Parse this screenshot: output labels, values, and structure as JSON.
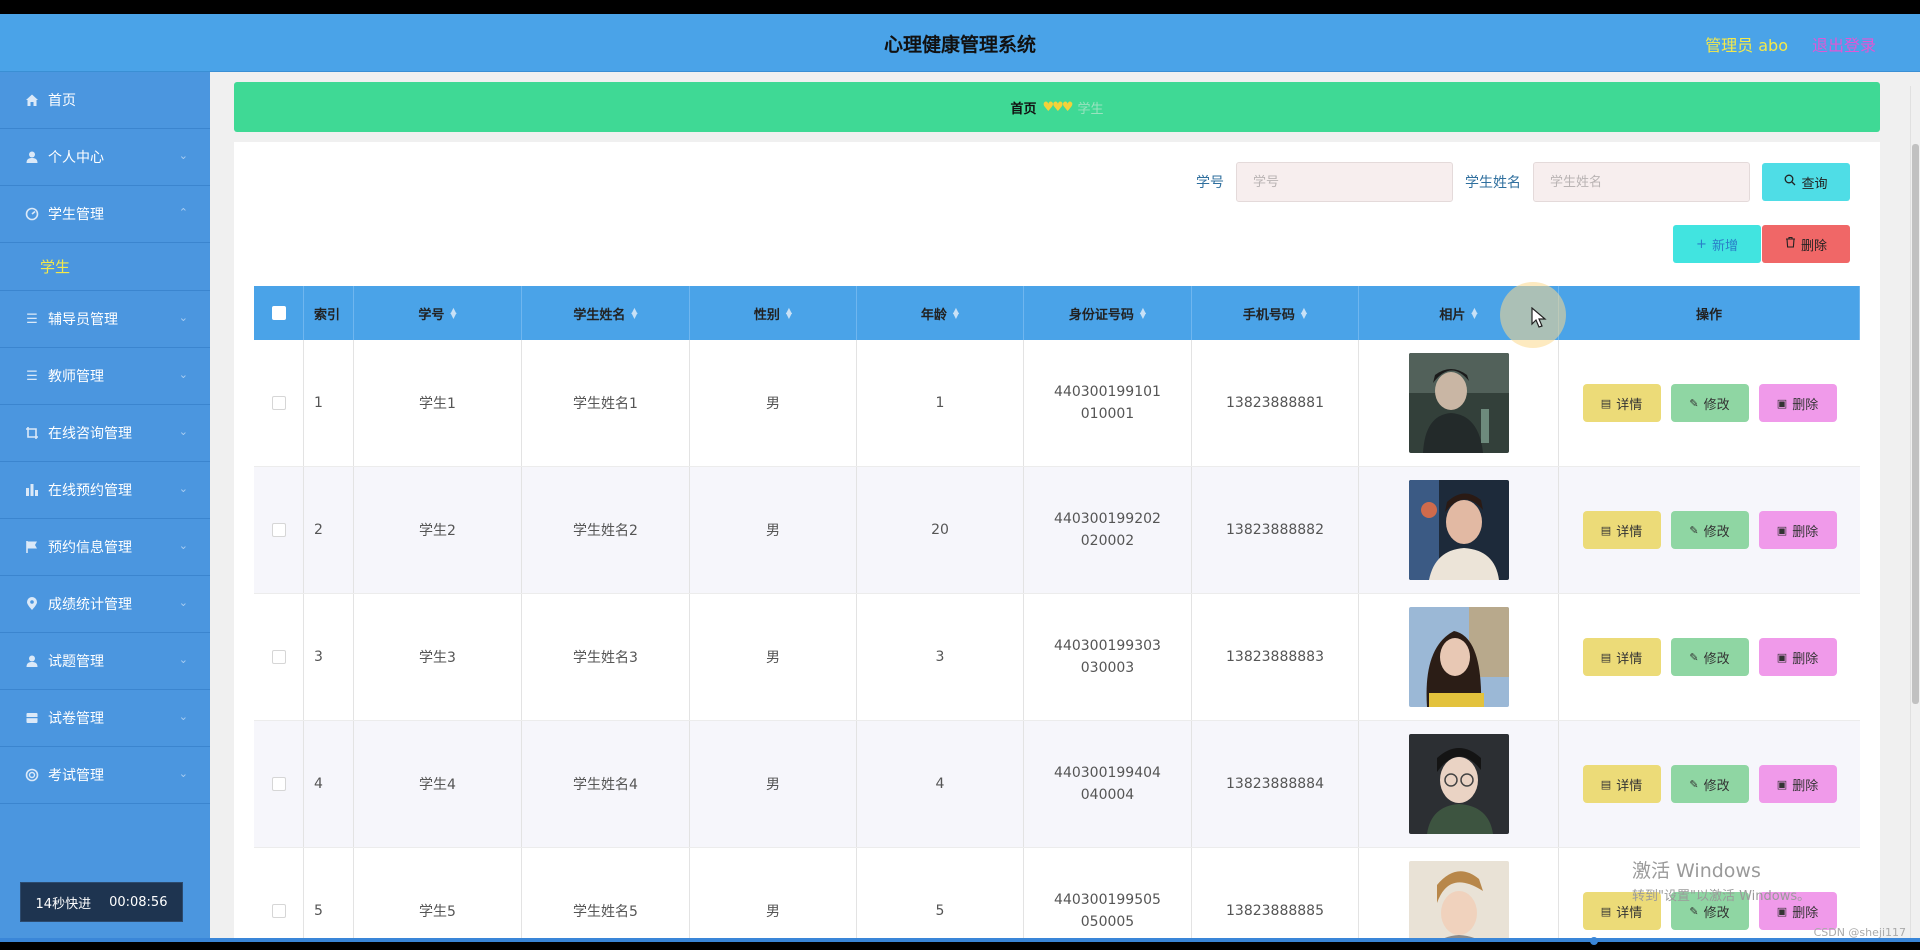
{
  "header": {
    "title": "心理健康管理系统",
    "admin": "管理员 abo",
    "logout": "退出登录"
  },
  "sidebar": {
    "items": [
      {
        "label": "首页",
        "icon": "home-icon"
      },
      {
        "label": "个人中心",
        "icon": "user-icon"
      },
      {
        "label": "学生管理",
        "icon": "dashboard-icon"
      },
      {
        "label": "辅导员管理",
        "icon": "list-icon"
      },
      {
        "label": "教师管理",
        "icon": "list-icon"
      },
      {
        "label": "在线咨询管理",
        "icon": "crop-icon"
      },
      {
        "label": "在线预约管理",
        "icon": "chart-icon"
      },
      {
        "label": "预约信息管理",
        "icon": "flag-icon"
      },
      {
        "label": "成绩统计管理",
        "icon": "location-icon"
      },
      {
        "label": "试题管理",
        "icon": "user-icon"
      },
      {
        "label": "试卷管理",
        "icon": "box-icon"
      },
      {
        "label": "考试管理",
        "icon": "circle-icon"
      }
    ],
    "submenu_active": "学生",
    "timer_label": "14秒快进",
    "timer_value": "00:08:56"
  },
  "breadcrumb": {
    "home": "首页",
    "separator": "♥♥♥",
    "current": "学生"
  },
  "search": {
    "sno_label": "学号",
    "sno_placeholder": "学号",
    "name_label": "学生姓名",
    "name_placeholder": "学生姓名",
    "query_button": "查询"
  },
  "actions": {
    "add": "新增",
    "delete": "删除"
  },
  "table": {
    "headers": {
      "index": "索引",
      "sno": "学号",
      "name": "学生姓名",
      "sex": "性别",
      "age": "年龄",
      "idcard": "身份证号码",
      "phone": "手机号码",
      "photo": "相片",
      "ops": "操作"
    },
    "ops": {
      "detail": "详情",
      "edit": "修改",
      "delete": "删除"
    },
    "rows": [
      {
        "index": "1",
        "sno": "学生1",
        "name": "学生姓名1",
        "sex": "男",
        "age": "1",
        "idcard": "440300199101010001",
        "phone": "13823888881"
      },
      {
        "index": "2",
        "sno": "学生2",
        "name": "学生姓名2",
        "sex": "男",
        "age": "20",
        "idcard": "440300199202020002",
        "phone": "13823888882"
      },
      {
        "index": "3",
        "sno": "学生3",
        "name": "学生姓名3",
        "sex": "男",
        "age": "3",
        "idcard": "440300199303030003",
        "phone": "13823888883"
      },
      {
        "index": "4",
        "sno": "学生4",
        "name": "学生姓名4",
        "sex": "男",
        "age": "4",
        "idcard": "440300199404040004",
        "phone": "13823888884"
      },
      {
        "index": "5",
        "sno": "学生5",
        "name": "学生姓名5",
        "sex": "男",
        "age": "5",
        "idcard": "440300199505050005",
        "phone": "13823888885"
      }
    ]
  },
  "watermark": {
    "line1": "激活 Windows",
    "line2": "转到\"设置\"以激活 Windows。",
    "csdn": "CSDN @sheji117"
  },
  "colors": {
    "header": "#4aa3e8",
    "sidebar": "#4b96df",
    "breadcrumb": "#3fd995",
    "detail": "#ecdb78",
    "edit": "#8fd6a3",
    "delete": "#f09aea"
  }
}
